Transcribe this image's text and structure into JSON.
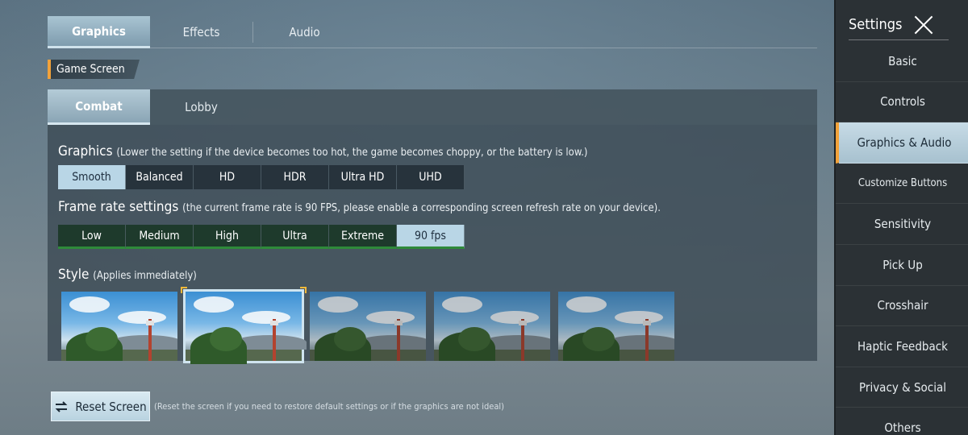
{
  "top_tabs": [
    "Graphics",
    "Effects",
    "Audio"
  ],
  "section_label": "Game Screen",
  "sub_tabs": [
    "Combat",
    "Lobby"
  ],
  "graphics": {
    "title": "Graphics",
    "note": "(Lower the setting if the device becomes too hot, the game becomes choppy, or the battery is low.)",
    "options": [
      "Smooth",
      "Balanced",
      "HD",
      "HDR",
      "Ultra HD",
      "UHD"
    ],
    "selected": "Smooth"
  },
  "frame_rate": {
    "title": "Frame rate settings",
    "note": "(the current frame rate is 90 FPS, please enable a corresponding screen refresh rate on your device).",
    "options": [
      "Low",
      "Medium",
      "High",
      "Ultra",
      "Extreme",
      "90 fps"
    ],
    "selected": "90 fps"
  },
  "style": {
    "title": "Style",
    "note": "(Applies immediately)",
    "count": 5,
    "selected_index": 1
  },
  "reset": {
    "label": "Reset Screen",
    "note": "(Reset the screen if you need to restore default settings or if the graphics are not ideal)"
  },
  "sidebar": {
    "title": "Settings",
    "items": [
      "Basic",
      "Controls",
      "Graphics & Audio",
      "Customize Buttons",
      "Sensitivity",
      "Pick Up",
      "Crosshair",
      "Haptic Feedback",
      "Privacy & Social",
      "Others"
    ],
    "active": "Graphics & Audio"
  },
  "colors": {
    "accent": "#f2a23a",
    "selected": "#b9d6e6",
    "fps_bar": "#2e8a3a"
  }
}
